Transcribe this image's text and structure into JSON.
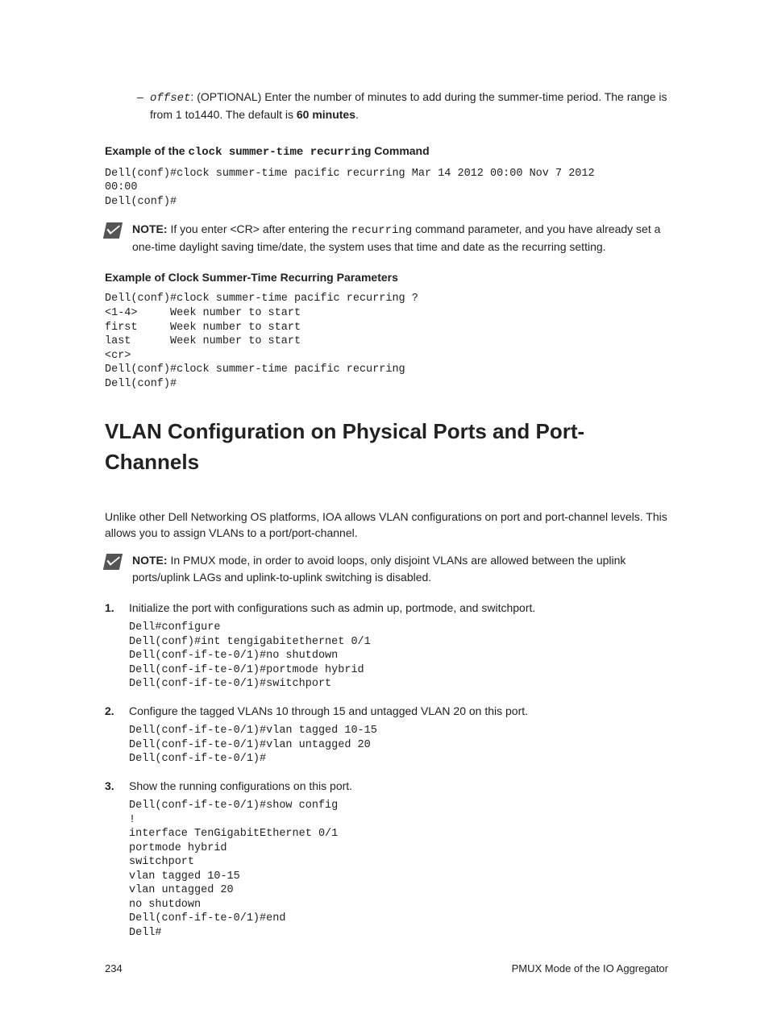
{
  "offset_item": {
    "label": "offset",
    "text_before": ": (OPTIONAL) Enter the number of minutes to add during the summer-time period. The range is from 1 to1440. The default is ",
    "bold_default": "60 minutes",
    "text_after": "."
  },
  "example1": {
    "heading_pre": "Example of the ",
    "heading_cmd": "clock summer-time recurring",
    "heading_post": " Command",
    "code": "Dell(conf)#clock summer-time pacific recurring Mar 14 2012 00:00 Nov 7 2012\n00:00\nDell(conf)#"
  },
  "note1": {
    "label": "NOTE:",
    "pre": " If you enter <CR> after entering the ",
    "mono": "recurring",
    "post": " command parameter, and you have already set a one-time daylight saving time/date, the system uses that time and date as the recurring setting."
  },
  "example2": {
    "heading": "Example of Clock Summer-Time Recurring Parameters",
    "code": "Dell(conf)#clock summer-time pacific recurring ?\n<1-4>     Week number to start\nfirst     Week number to start\nlast      Week number to start\n<cr>\nDell(conf)#clock summer-time pacific recurring\nDell(conf)#"
  },
  "section_title": "VLAN Configuration on Physical Ports and Port-Channels",
  "intro": "Unlike other Dell Networking OS platforms, IOA allows VLAN configurations on port and port-channel levels. This allows you to assign VLANs to a port/port-channel.",
  "note2": {
    "label": "NOTE:",
    "text": " In PMUX mode, in order to avoid loops, only disjoint VLANs are allowed between the uplink ports/uplink LAGs and uplink-to-uplink switching is disabled."
  },
  "steps": [
    {
      "num": "1.",
      "text": "Initialize the port with configurations such as admin up, portmode, and switchport.",
      "code": "Dell#configure\nDell(conf)#int tengigabitethernet 0/1\nDell(conf-if-te-0/1)#no shutdown\nDell(conf-if-te-0/1)#portmode hybrid\nDell(conf-if-te-0/1)#switchport"
    },
    {
      "num": "2.",
      "text": "Configure the tagged VLANs 10 through 15 and untagged VLAN 20 on this port.",
      "code": "Dell(conf-if-te-0/1)#vlan tagged 10-15\nDell(conf-if-te-0/1)#vlan untagged 20\nDell(conf-if-te-0/1)#"
    },
    {
      "num": "3.",
      "text": "Show the running configurations on this port.",
      "code": "Dell(conf-if-te-0/1)#show config\n!\ninterface TenGigabitEthernet 0/1\nportmode hybrid\nswitchport\nvlan tagged 10-15\nvlan untagged 20\nno shutdown\nDell(conf-if-te-0/1)#end\nDell#"
    }
  ],
  "footer": {
    "page": "234",
    "label": "PMUX Mode of the IO Aggregator"
  }
}
